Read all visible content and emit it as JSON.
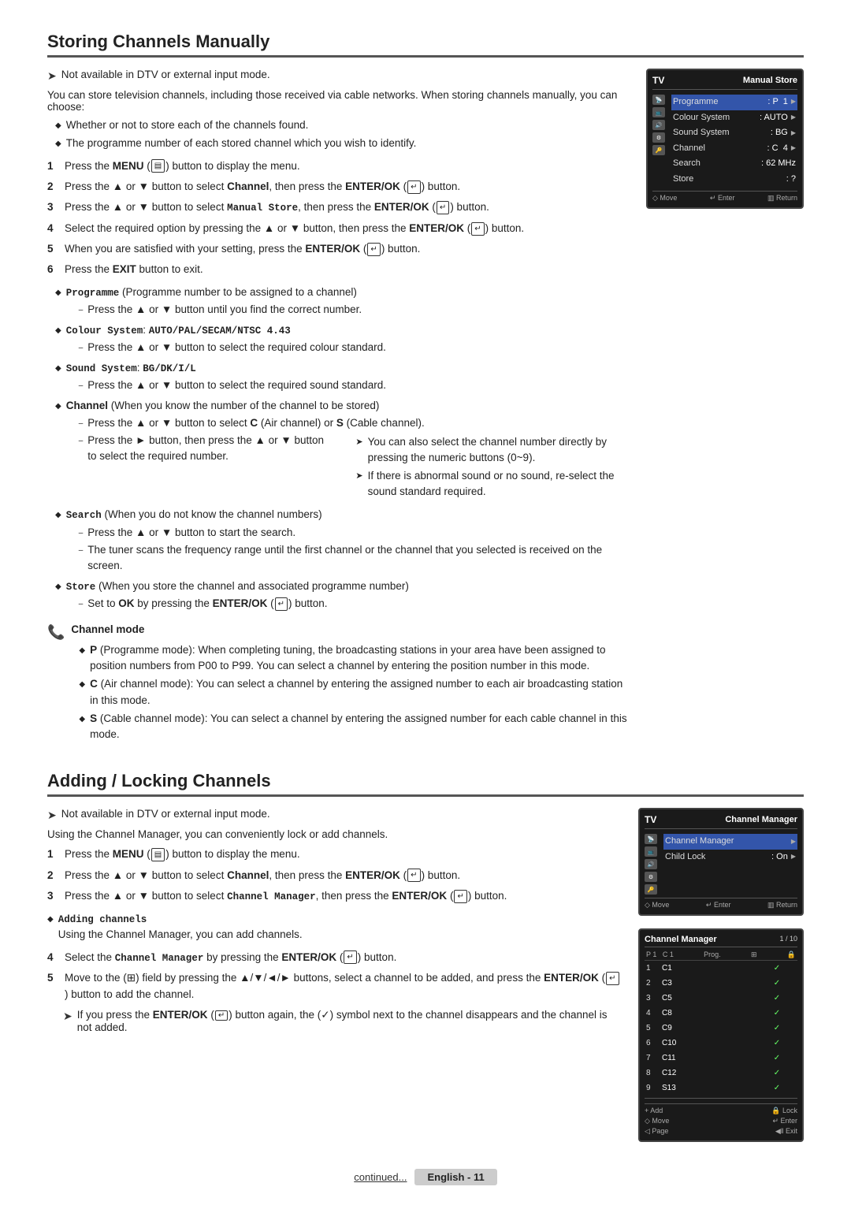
{
  "page": {
    "sections": [
      {
        "id": "storing-channels",
        "title": "Storing Channels Manually",
        "note": "Not available in DTV or external input mode.",
        "intro": "You can store television channels, including those received via cable networks. When storing channels manually, you can choose:",
        "bullets": [
          "Whether or not to store each of the channels found.",
          "The programme number of each stored channel which you wish to identify."
        ],
        "steps": [
          {
            "num": "1",
            "text": "Press the MENU (▤) button to display the menu."
          },
          {
            "num": "2",
            "text": "Press the ▲ or ▼ button to select Channel, then press the ENTER/OK (↵) button."
          },
          {
            "num": "3",
            "text": "Press the ▲ or ▼ button to select Manual Store, then press the ENTER/OK (↵) button."
          },
          {
            "num": "4",
            "text": "Select the required option by pressing the ▲ or ▼ button, then press the ENTER/OK (↵) button."
          },
          {
            "num": "5",
            "text": "When you are satisfied with your setting, press the ENTER/OK (↵) button."
          },
          {
            "num": "6",
            "text": "Press the EXIT button to exit."
          }
        ],
        "detail_bullets": [
          {
            "label": "Programme",
            "text": "(Programme number to be assigned to a channel)",
            "subs": [
              "Press the ▲ or ▼ button until you find the correct number."
            ]
          },
          {
            "label": "Colour System",
            "text": ": AUTO/PAL/SECAM/NTSC 4.43",
            "subs": [
              "Press the ▲ or ▼ button to select the required colour standard."
            ]
          },
          {
            "label": "Sound System",
            "text": ": BG/DK/I/L",
            "subs": [
              "Press the ▲ or ▼ button to select the required sound standard."
            ]
          },
          {
            "label": "Channel",
            "text": "(When you know the number of the channel to be stored)",
            "subs": [
              "Press the ▲ or ▼ button to select C (Air channel) or S (Cable channel).",
              "Press the ► button, then press the ▲ or ▼ button to select the required number."
            ],
            "subsubs": [
              "You can also select the channel number directly by pressing the numeric buttons (0~9).",
              "If there is abnormal sound or no sound, re-select the sound standard required."
            ]
          },
          {
            "label": "Search",
            "text": "(When you do not know the channel numbers)",
            "subs": [
              "Press the ▲ or ▼ button to start the search.",
              "The tuner scans the frequency range until the first channel or the channel that you selected is received on the screen."
            ]
          },
          {
            "label": "Store",
            "text": "(When you store the channel and associated programme number)",
            "subs": [
              "Set to OK by pressing the ENTER/OK (↵) button."
            ]
          }
        ],
        "channel_mode": {
          "title": "Channel mode",
          "items": [
            {
              "label": "P",
              "text": "(Programme mode): When completing tuning, the broadcasting stations in your area have been assigned to position numbers from P00 to P99. You can select a channel by entering the position number in this mode."
            },
            {
              "label": "C",
              "text": "(Air channel mode): You can select a channel by entering the assigned number to each air broadcasting station in this mode."
            },
            {
              "label": "S",
              "text": "(Cable channel mode): You can select a channel by entering the assigned number for each cable channel in this mode."
            }
          ]
        },
        "tv_screen": {
          "logo": "TV",
          "title": "Manual Store",
          "rows": [
            {
              "label": "Programme",
              "value": ": P  1",
              "arrow": true
            },
            {
              "label": "Colour System",
              "value": ": AUTO",
              "arrow": true
            },
            {
              "label": "Sound System",
              "value": ": BG",
              "arrow": true
            },
            {
              "label": "Channel",
              "value": ": C  4",
              "arrow": true
            },
            {
              "label": "Search",
              "value": ": 62 MHz",
              "arrow": false
            },
            {
              "label": "Store",
              "value": ": ?",
              "arrow": false
            }
          ],
          "footer": [
            "◇ Move",
            "↵ Enter",
            "▥ Return"
          ]
        }
      },
      {
        "id": "adding-locking",
        "title": "Adding / Locking Channels",
        "note": "Not available in DTV or external input mode.",
        "intro": "Using the Channel Manager, you can conveniently lock or add channels.",
        "steps": [
          {
            "num": "1",
            "text": "Press the MENU (▤) button to display the menu."
          },
          {
            "num": "2",
            "text": "Press the ▲ or ▼ button to select Channel, then press the ENTER/OK (↵) button."
          },
          {
            "num": "3",
            "text": "Press the ▲ or ▼ button to select Channel Manager, then press the ENTER/OK (↵) button."
          },
          {
            "num": "4",
            "text": "Select the Channel Manager by pressing the ENTER/OK (↵) button.",
            "bold_part": "Channel Manager"
          },
          {
            "num": "5",
            "text": "Move to the (⊞) field by pressing the ▲/▼/◄/► buttons, select a channel to be added, and press the ENTER/OK (↵) button to add the channel."
          },
          {
            "num": "note",
            "text": "If you press the ENTER/OK (↵) button again, the (✓) symbol next to the channel disappears and the channel is not added."
          }
        ],
        "adding_channels": {
          "label": "Adding channels",
          "text": "Using the Channel Manager, you can add channels."
        },
        "tv_screen_top": {
          "logo": "TV",
          "title": "Channel Manager",
          "rows": [
            {
              "label": "Channel Manager",
              "value": "",
              "arrow": true
            },
            {
              "label": "Child Lock",
              "value": ": On",
              "arrow": true
            }
          ],
          "footer": [
            "◇ Move",
            "↵ Enter",
            "▥ Return"
          ]
        },
        "tv_screen_bottom": {
          "title": "Channel Manager",
          "page": "1 / 10",
          "cols": [
            "P 1  C 1",
            "Prog.",
            "⊞",
            "🔒"
          ],
          "rows": [
            {
              "num": "1",
              "chan": "C1",
              "check": "✓",
              "lock": "",
              "selected": false
            },
            {
              "num": "2",
              "chan": "C3",
              "check": "✓",
              "lock": "",
              "selected": false
            },
            {
              "num": "3",
              "chan": "C5",
              "check": "✓",
              "lock": "",
              "selected": false
            },
            {
              "num": "4",
              "chan": "C8",
              "check": "✓",
              "lock": "",
              "selected": false
            },
            {
              "num": "5",
              "chan": "C9",
              "check": "✓",
              "lock": "",
              "selected": false
            },
            {
              "num": "6",
              "chan": "C10",
              "check": "✓",
              "lock": "",
              "selected": false
            },
            {
              "num": "7",
              "chan": "C11",
              "check": "✓",
              "lock": "",
              "selected": false
            },
            {
              "num": "8",
              "chan": "C12",
              "check": "✓",
              "lock": "",
              "selected": false
            },
            {
              "num": "9",
              "chan": "S13",
              "check": "✓",
              "lock": "",
              "selected": false
            }
          ],
          "footer1": [
            "+ Add",
            "🔒 Lock"
          ],
          "footer2": [
            "◇ Move",
            "↵ Enter"
          ],
          "footer3": [
            "◁ Page",
            "◀‖ Exit"
          ]
        }
      }
    ],
    "bottom": {
      "continued": "continued...",
      "language_label": "English - 11"
    }
  }
}
